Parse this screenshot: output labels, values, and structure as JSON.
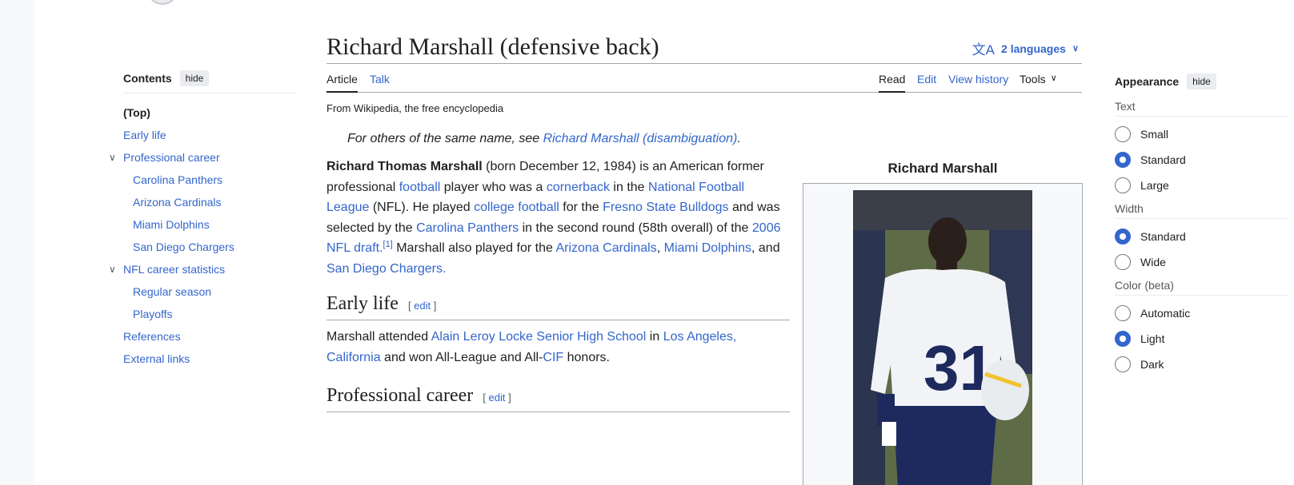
{
  "title": "Richard Marshall (defensive back)",
  "languages_label": "2 languages",
  "toc": {
    "title": "Contents",
    "hide_label": "hide",
    "items": [
      {
        "label": "(Top)"
      },
      {
        "label": "Early life"
      },
      {
        "label": "Professional career"
      },
      {
        "label": "Carolina Panthers"
      },
      {
        "label": "Arizona Cardinals"
      },
      {
        "label": "Miami Dolphins"
      },
      {
        "label": "San Diego Chargers"
      },
      {
        "label": "NFL career statistics"
      },
      {
        "label": "Regular season"
      },
      {
        "label": "Playoffs"
      },
      {
        "label": "References"
      },
      {
        "label": "External links"
      }
    ]
  },
  "tabs": {
    "article": "Article",
    "talk": "Talk",
    "read": "Read",
    "edit": "Edit",
    "history": "View history",
    "tools": "Tools"
  },
  "tagline": "From Wikipedia, the free encyclopedia",
  "hatnote": {
    "prefix": "For others of the same name, see ",
    "link": "Richard Marshall (disambiguation)",
    "suffix": "."
  },
  "intro": {
    "bold_name": "Richard Thomas Marshall",
    "t1": " (born December 12, 1984) is an American former professional ",
    "l1": "football",
    "t2": " player who was a ",
    "l2": "cornerback",
    "t3": " in the ",
    "l3": "National Football League",
    "t4": " (NFL). He played ",
    "l4": "college football",
    "t5": " for the ",
    "l5": "Fresno State Bulldogs",
    "t6": " and was selected by the ",
    "l6": "Carolina Panthers",
    "t7": " in the second round (58th overall) of the ",
    "l7": "2006 NFL draft",
    "t8": ".",
    "ref": "[1]",
    "t9": " Marshall also played for the ",
    "l8": "Arizona Cardinals",
    "t10": ", ",
    "l9": "Miami Dolphins",
    "t11": ", and ",
    "l10": "San Diego Chargers",
    "t12": "."
  },
  "early_life": {
    "heading": "Early life",
    "edit": "edit",
    "t1": "Marshall attended ",
    "l1": "Alain Leroy Locke Senior High School",
    "t2": " in ",
    "l2": "Los Angeles, California",
    "t3": " and won All-League and All-",
    "l3": "CIF",
    "t4": " honors."
  },
  "pro_career": {
    "heading": "Professional career",
    "edit": "edit"
  },
  "infobox": {
    "title": "Richard Marshall",
    "photo_desc": "Player photo"
  },
  "appearance": {
    "title": "Appearance",
    "hide_label": "hide",
    "text_label": "Text",
    "text_options": [
      "Small",
      "Standard",
      "Large"
    ],
    "text_selected": "Standard",
    "width_label": "Width",
    "width_options": [
      "Standard",
      "Wide"
    ],
    "width_selected": "Standard",
    "color_label": "Color (beta)",
    "color_options": [
      "Automatic",
      "Light",
      "Dark"
    ],
    "color_selected": "Light"
  },
  "colors": {
    "link": "#3366cc",
    "text": "#202122",
    "border": "#a2a9b1"
  }
}
